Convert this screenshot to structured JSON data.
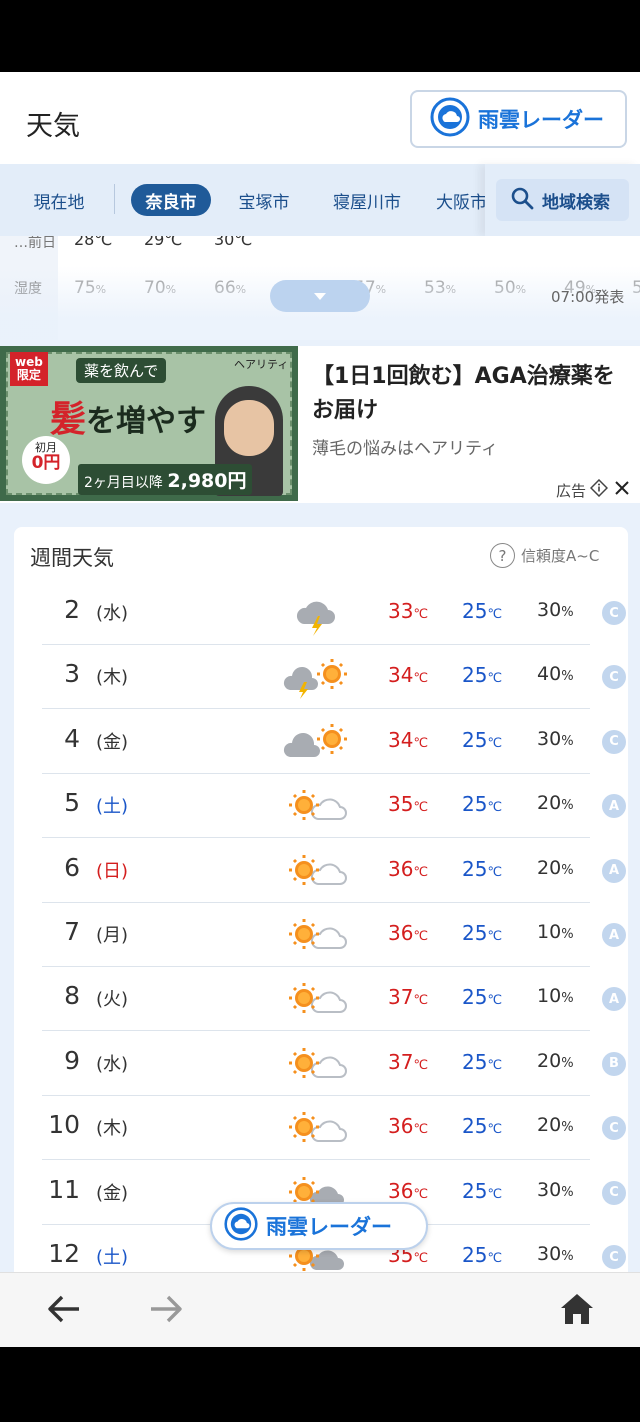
{
  "header": {
    "title": "天気",
    "radar_button": "雨雲レーダー"
  },
  "tabs": {
    "items": [
      "現在地",
      "奈良市",
      "宝塚市",
      "寝屋川市",
      "大阪市"
    ],
    "active": "奈良市",
    "search_label": "地域検索"
  },
  "hourly": {
    "prev_label": "前日",
    "prev_temps": [
      "28℃",
      "29℃",
      "30℃"
    ],
    "humidity_label": "湿度",
    "humidity": [
      "75",
      "70",
      "66",
      "",
      "57",
      "53",
      "50",
      "49",
      "5"
    ],
    "issued": "07:00発表"
  },
  "ad": {
    "title": "【1日1回飲む】AGA治療薬をお届け",
    "subtitle": "薄毛の悩みはヘアリティ",
    "label": "広告",
    "image_text": {
      "web": "web\n限定",
      "headline": "薬を飲んで",
      "big1": "髪",
      "big2": "を増やす",
      "first_month": "初月",
      "first_price": "0円",
      "second": "2ヶ月目以降",
      "price": "2,980円",
      "brand": "ヘアリティ"
    }
  },
  "weekly": {
    "title": "週間天気",
    "reliability_label": "信頼度A~C",
    "unit_temp": "℃",
    "unit_pop": "%",
    "rows": [
      {
        "day": "2",
        "dow": "(水)",
        "dow_type": "weekday",
        "icon": "cloud-thunder-icon",
        "hi": "33",
        "lo": "25",
        "pop": "30",
        "conf": "C"
      },
      {
        "day": "3",
        "dow": "(木)",
        "dow_type": "weekday",
        "icon": "thunder-cloud-sun-icon",
        "hi": "34",
        "lo": "25",
        "pop": "40",
        "conf": "C"
      },
      {
        "day": "4",
        "dow": "(金)",
        "dow_type": "weekday",
        "icon": "cloud-sun-icon",
        "hi": "34",
        "lo": "25",
        "pop": "30",
        "conf": "C"
      },
      {
        "day": "5",
        "dow": "(土)",
        "dow_type": "sat",
        "icon": "sun-cloud-icon",
        "hi": "35",
        "lo": "25",
        "pop": "20",
        "conf": "A"
      },
      {
        "day": "6",
        "dow": "(日)",
        "dow_type": "sun",
        "icon": "sun-cloud-icon",
        "hi": "36",
        "lo": "25",
        "pop": "20",
        "conf": "A"
      },
      {
        "day": "7",
        "dow": "(月)",
        "dow_type": "weekday",
        "icon": "sun-cloud-icon",
        "hi": "36",
        "lo": "25",
        "pop": "10",
        "conf": "A"
      },
      {
        "day": "8",
        "dow": "(火)",
        "dow_type": "weekday",
        "icon": "sun-cloud-icon",
        "hi": "37",
        "lo": "25",
        "pop": "10",
        "conf": "A"
      },
      {
        "day": "9",
        "dow": "(水)",
        "dow_type": "weekday",
        "icon": "sun-cloud-icon",
        "hi": "37",
        "lo": "25",
        "pop": "20",
        "conf": "B"
      },
      {
        "day": "10",
        "dow": "(木)",
        "dow_type": "weekday",
        "icon": "sun-cloud-icon",
        "hi": "36",
        "lo": "25",
        "pop": "20",
        "conf": "C"
      },
      {
        "day": "11",
        "dow": "(金)",
        "dow_type": "weekday",
        "icon": "sun-darkcloud-icon",
        "hi": "36",
        "lo": "25",
        "pop": "30",
        "conf": "C"
      },
      {
        "day": "12",
        "dow": "(土)",
        "dow_type": "sat",
        "icon": "sun-darkcloud-icon",
        "hi": "35",
        "lo": "25",
        "pop": "30",
        "conf": "C"
      }
    ]
  },
  "float_radar": "雨雲レーダー",
  "nav": {
    "back": "back-arrow-icon",
    "forward": "forward-arrow-icon",
    "home": "home-icon"
  },
  "colors": {
    "accent": "#1a73d9",
    "hi": "#d41e1e",
    "lo": "#1a56c8",
    "active_tab": "#1f5a99"
  }
}
